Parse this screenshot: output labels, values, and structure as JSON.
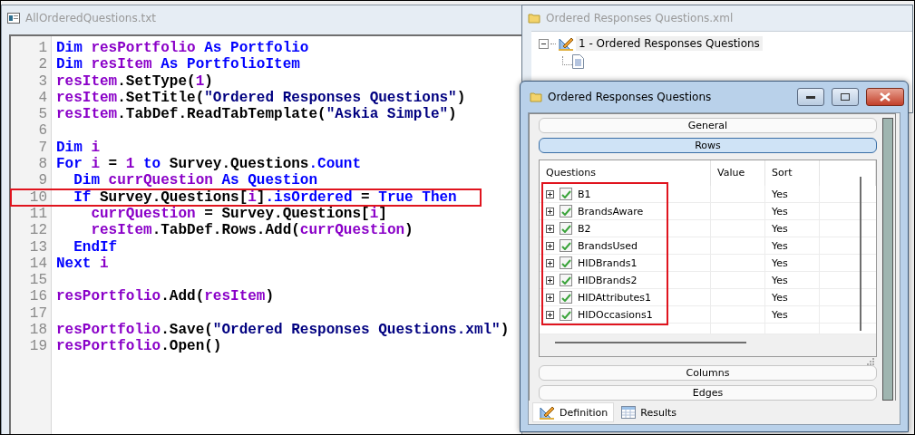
{
  "editor": {
    "title": "AllOrderedQuestions.txt",
    "lines": [
      {
        "number": "1",
        "boxed": false,
        "tokens": [
          {
            "kind": "kw",
            "text": "Dim "
          },
          {
            "kind": "var",
            "text": "resPortfolio "
          },
          {
            "kind": "kw",
            "text": "As Portfolio"
          }
        ]
      },
      {
        "number": "2",
        "boxed": false,
        "tokens": [
          {
            "kind": "kw",
            "text": "Dim "
          },
          {
            "kind": "var",
            "text": "resItem "
          },
          {
            "kind": "kw",
            "text": "As PortfolioItem"
          }
        ]
      },
      {
        "number": "3",
        "boxed": false,
        "tokens": [
          {
            "kind": "var",
            "text": "resItem"
          },
          {
            "kind": "txt",
            "text": ".SetType("
          },
          {
            "kind": "var",
            "text": "1"
          },
          {
            "kind": "txt",
            "text": ")"
          }
        ]
      },
      {
        "number": "4",
        "boxed": false,
        "tokens": [
          {
            "kind": "var",
            "text": "resItem"
          },
          {
            "kind": "txt",
            "text": ".SetTitle("
          },
          {
            "kind": "str",
            "text": "\"Ordered Responses Questions\""
          },
          {
            "kind": "txt",
            "text": ")"
          }
        ]
      },
      {
        "number": "5",
        "boxed": false,
        "tokens": [
          {
            "kind": "var",
            "text": "resItem"
          },
          {
            "kind": "txt",
            "text": ".TabDef.ReadTabTemplate("
          },
          {
            "kind": "str",
            "text": "\"Askia Simple\""
          },
          {
            "kind": "txt",
            "text": ")"
          }
        ]
      },
      {
        "number": "6",
        "boxed": false
      },
      {
        "number": "7",
        "boxed": false,
        "tokens": [
          {
            "kind": "kw",
            "text": "Dim "
          },
          {
            "kind": "var",
            "text": "i"
          }
        ]
      },
      {
        "number": "8",
        "boxed": false,
        "tokens": [
          {
            "kind": "kw",
            "text": "For "
          },
          {
            "kind": "var",
            "text": "i "
          },
          {
            "kind": "txt",
            "text": "= "
          },
          {
            "kind": "var",
            "text": "1 "
          },
          {
            "kind": "kw",
            "text": "to "
          },
          {
            "kind": "txt",
            "text": "Survey.Questions"
          },
          {
            "kind": "kw",
            "text": ".Count"
          }
        ]
      },
      {
        "number": "9",
        "boxed": false,
        "tokens": [
          {
            "kind": "kw",
            "text": "  Dim "
          },
          {
            "kind": "var",
            "text": "currQuestion "
          },
          {
            "kind": "kw",
            "text": "As Question"
          }
        ]
      },
      {
        "number": "10",
        "boxed": true,
        "tokens": [
          {
            "kind": "kw",
            "text": "  If "
          },
          {
            "kind": "txt",
            "text": "Survey.Questions["
          },
          {
            "kind": "var",
            "text": "i"
          },
          {
            "kind": "txt",
            "text": "]"
          },
          {
            "kind": "kw",
            "text": ".isOrdered "
          },
          {
            "kind": "txt",
            "text": "= "
          },
          {
            "kind": "kw",
            "text": "True Then"
          }
        ]
      },
      {
        "number": "11",
        "boxed": false,
        "tokens": [
          {
            "kind": "var",
            "text": "    currQuestion "
          },
          {
            "kind": "txt",
            "text": "= Survey.Questions["
          },
          {
            "kind": "var",
            "text": "i"
          },
          {
            "kind": "txt",
            "text": "]"
          }
        ]
      },
      {
        "number": "12",
        "boxed": false,
        "tokens": [
          {
            "kind": "var",
            "text": "    resItem"
          },
          {
            "kind": "txt",
            "text": ".TabDef.Rows.Add("
          },
          {
            "kind": "var",
            "text": "currQuestion"
          },
          {
            "kind": "txt",
            "text": ")"
          }
        ]
      },
      {
        "number": "13",
        "boxed": false,
        "tokens": [
          {
            "kind": "kw",
            "text": "  EndIf"
          }
        ]
      },
      {
        "number": "14",
        "boxed": false,
        "tokens": [
          {
            "kind": "kw",
            "text": "Next "
          },
          {
            "kind": "var",
            "text": "i"
          }
        ]
      },
      {
        "number": "15",
        "boxed": false
      },
      {
        "number": "16",
        "boxed": false,
        "tokens": [
          {
            "kind": "var",
            "text": "resPortfolio"
          },
          {
            "kind": "txt",
            "text": ".Add("
          },
          {
            "kind": "var",
            "text": "resItem"
          },
          {
            "kind": "txt",
            "text": ")"
          }
        ]
      },
      {
        "number": "17",
        "boxed": false
      },
      {
        "number": "18",
        "boxed": false,
        "tokens": [
          {
            "kind": "var",
            "text": "resPortfolio"
          },
          {
            "kind": "txt",
            "text": ".Save("
          },
          {
            "kind": "str",
            "text": "\"Ordered Responses Questions.xml\""
          },
          {
            "kind": "txt",
            "text": ")"
          }
        ]
      },
      {
        "number": "19",
        "boxed": false,
        "tokens": [
          {
            "kind": "var",
            "text": "resPortfolio"
          },
          {
            "kind": "txt",
            "text": ".Open()"
          }
        ]
      }
    ]
  },
  "explorer": {
    "title": "Ordered Responses Questions.xml",
    "tree": [
      {
        "label": "1 - Ordered Responses Questions",
        "expanded": true,
        "children": [
          {
            "kind": "document"
          }
        ]
      }
    ]
  },
  "dialog": {
    "title": "Ordered Responses Questions",
    "sections": [
      {
        "label": "General",
        "selected": false
      },
      {
        "label": "Rows",
        "selected": true
      }
    ],
    "table": {
      "columns": [
        "Questions",
        "Value",
        "Sort"
      ],
      "questions_boxed": true,
      "rows": [
        {
          "name": "B1",
          "expanded": false,
          "checked": true,
          "sort": "Yes"
        },
        {
          "name": "BrandsAware",
          "expanded": false,
          "checked": true,
          "sort": "Yes"
        },
        {
          "name": "B2",
          "expanded": false,
          "checked": true,
          "sort": "Yes"
        },
        {
          "name": "BrandsUsed",
          "expanded": false,
          "checked": true,
          "sort": "Yes"
        },
        {
          "name": "HIDBrands1",
          "expanded": false,
          "checked": true,
          "sort": "Yes"
        },
        {
          "name": "HIDBrands2",
          "expanded": false,
          "checked": true,
          "sort": "Yes"
        },
        {
          "name": "HIDAttributes1",
          "expanded": false,
          "checked": true,
          "sort": "Yes"
        },
        {
          "name": "HIDOccasions1",
          "expanded": false,
          "checked": true,
          "sort": "Yes"
        }
      ]
    },
    "sections_after": [
      {
        "label": "Columns",
        "selected": false
      },
      {
        "label": "Edges",
        "selected": false
      }
    ],
    "tabs": [
      {
        "label": "Definition",
        "selected": true,
        "kind": "definition"
      },
      {
        "label": "Results",
        "selected": false,
        "kind": "results"
      }
    ]
  }
}
